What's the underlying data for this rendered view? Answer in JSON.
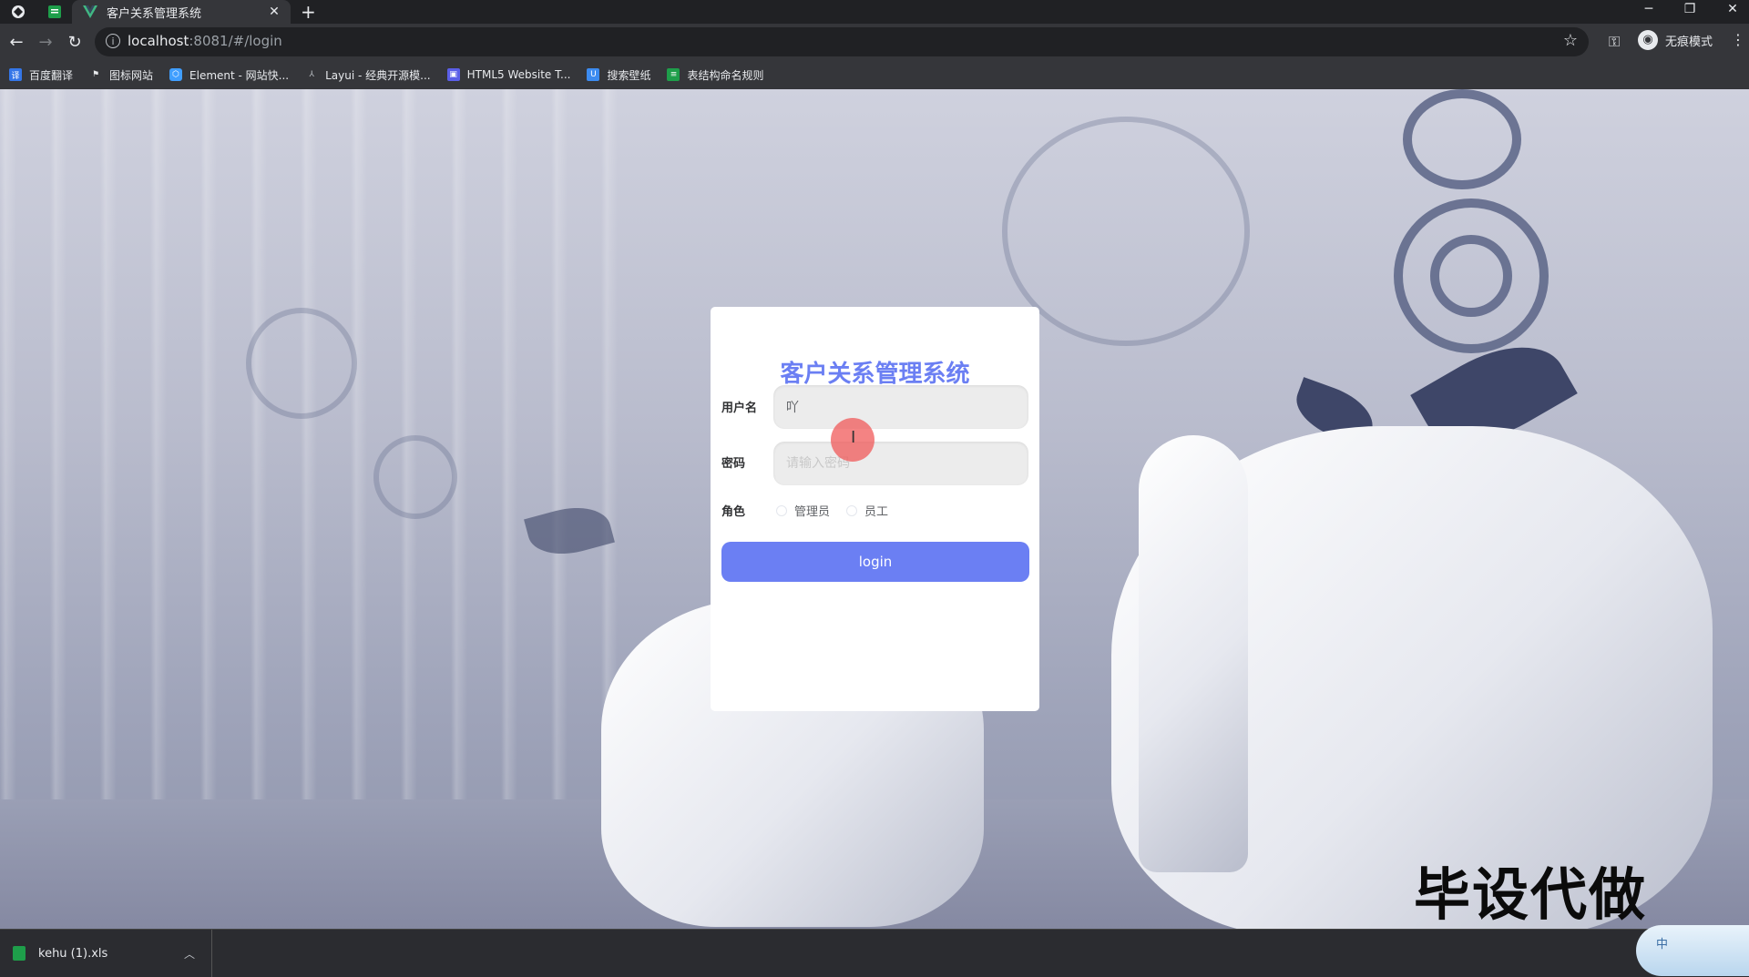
{
  "browser": {
    "tab_title": "客户关系管理系统",
    "new_tab_label": "+",
    "url_host": "localhost",
    "url_rest": ":8081/#/login",
    "incognito_label": "无痕模式",
    "window_controls": {
      "minimize": "─",
      "restore": "❐",
      "close": "✕"
    }
  },
  "bookmarks": [
    {
      "label": "百度翻译",
      "icon": "translate-icon",
      "color": "#3476e8"
    },
    {
      "label": "图标网站",
      "icon": "flag-icon",
      "color": "#e8eaed"
    },
    {
      "label": "Element - 网站快...",
      "icon": "element-icon",
      "color": "#409eff"
    },
    {
      "label": "Layui - 经典开源模...",
      "icon": "layui-icon",
      "color": "#bdc1c6"
    },
    {
      "label": "HTML5 Website T...",
      "icon": "html5-icon",
      "color": "#5b5fe8"
    },
    {
      "label": "搜索壁纸",
      "icon": "wallpaper-icon",
      "color": "#3c8bf0"
    },
    {
      "label": "表结构命名规则",
      "icon": "doc-icon",
      "color": "#1e9e4a"
    }
  ],
  "login": {
    "title": "客户关系管理系统",
    "username_label": "用户名",
    "username_value": "吖",
    "password_label": "密码",
    "password_placeholder": "请输入密码",
    "role_label": "角色",
    "role_options": [
      "管理员",
      "员工"
    ],
    "submit_label": "login",
    "accent_color": "#6b7ff3"
  },
  "watermark": "毕设代做",
  "downloads": {
    "file_name": "kehu (1).xls",
    "expand_icon": "chevron-up-icon"
  },
  "ime": {
    "label": "中"
  }
}
